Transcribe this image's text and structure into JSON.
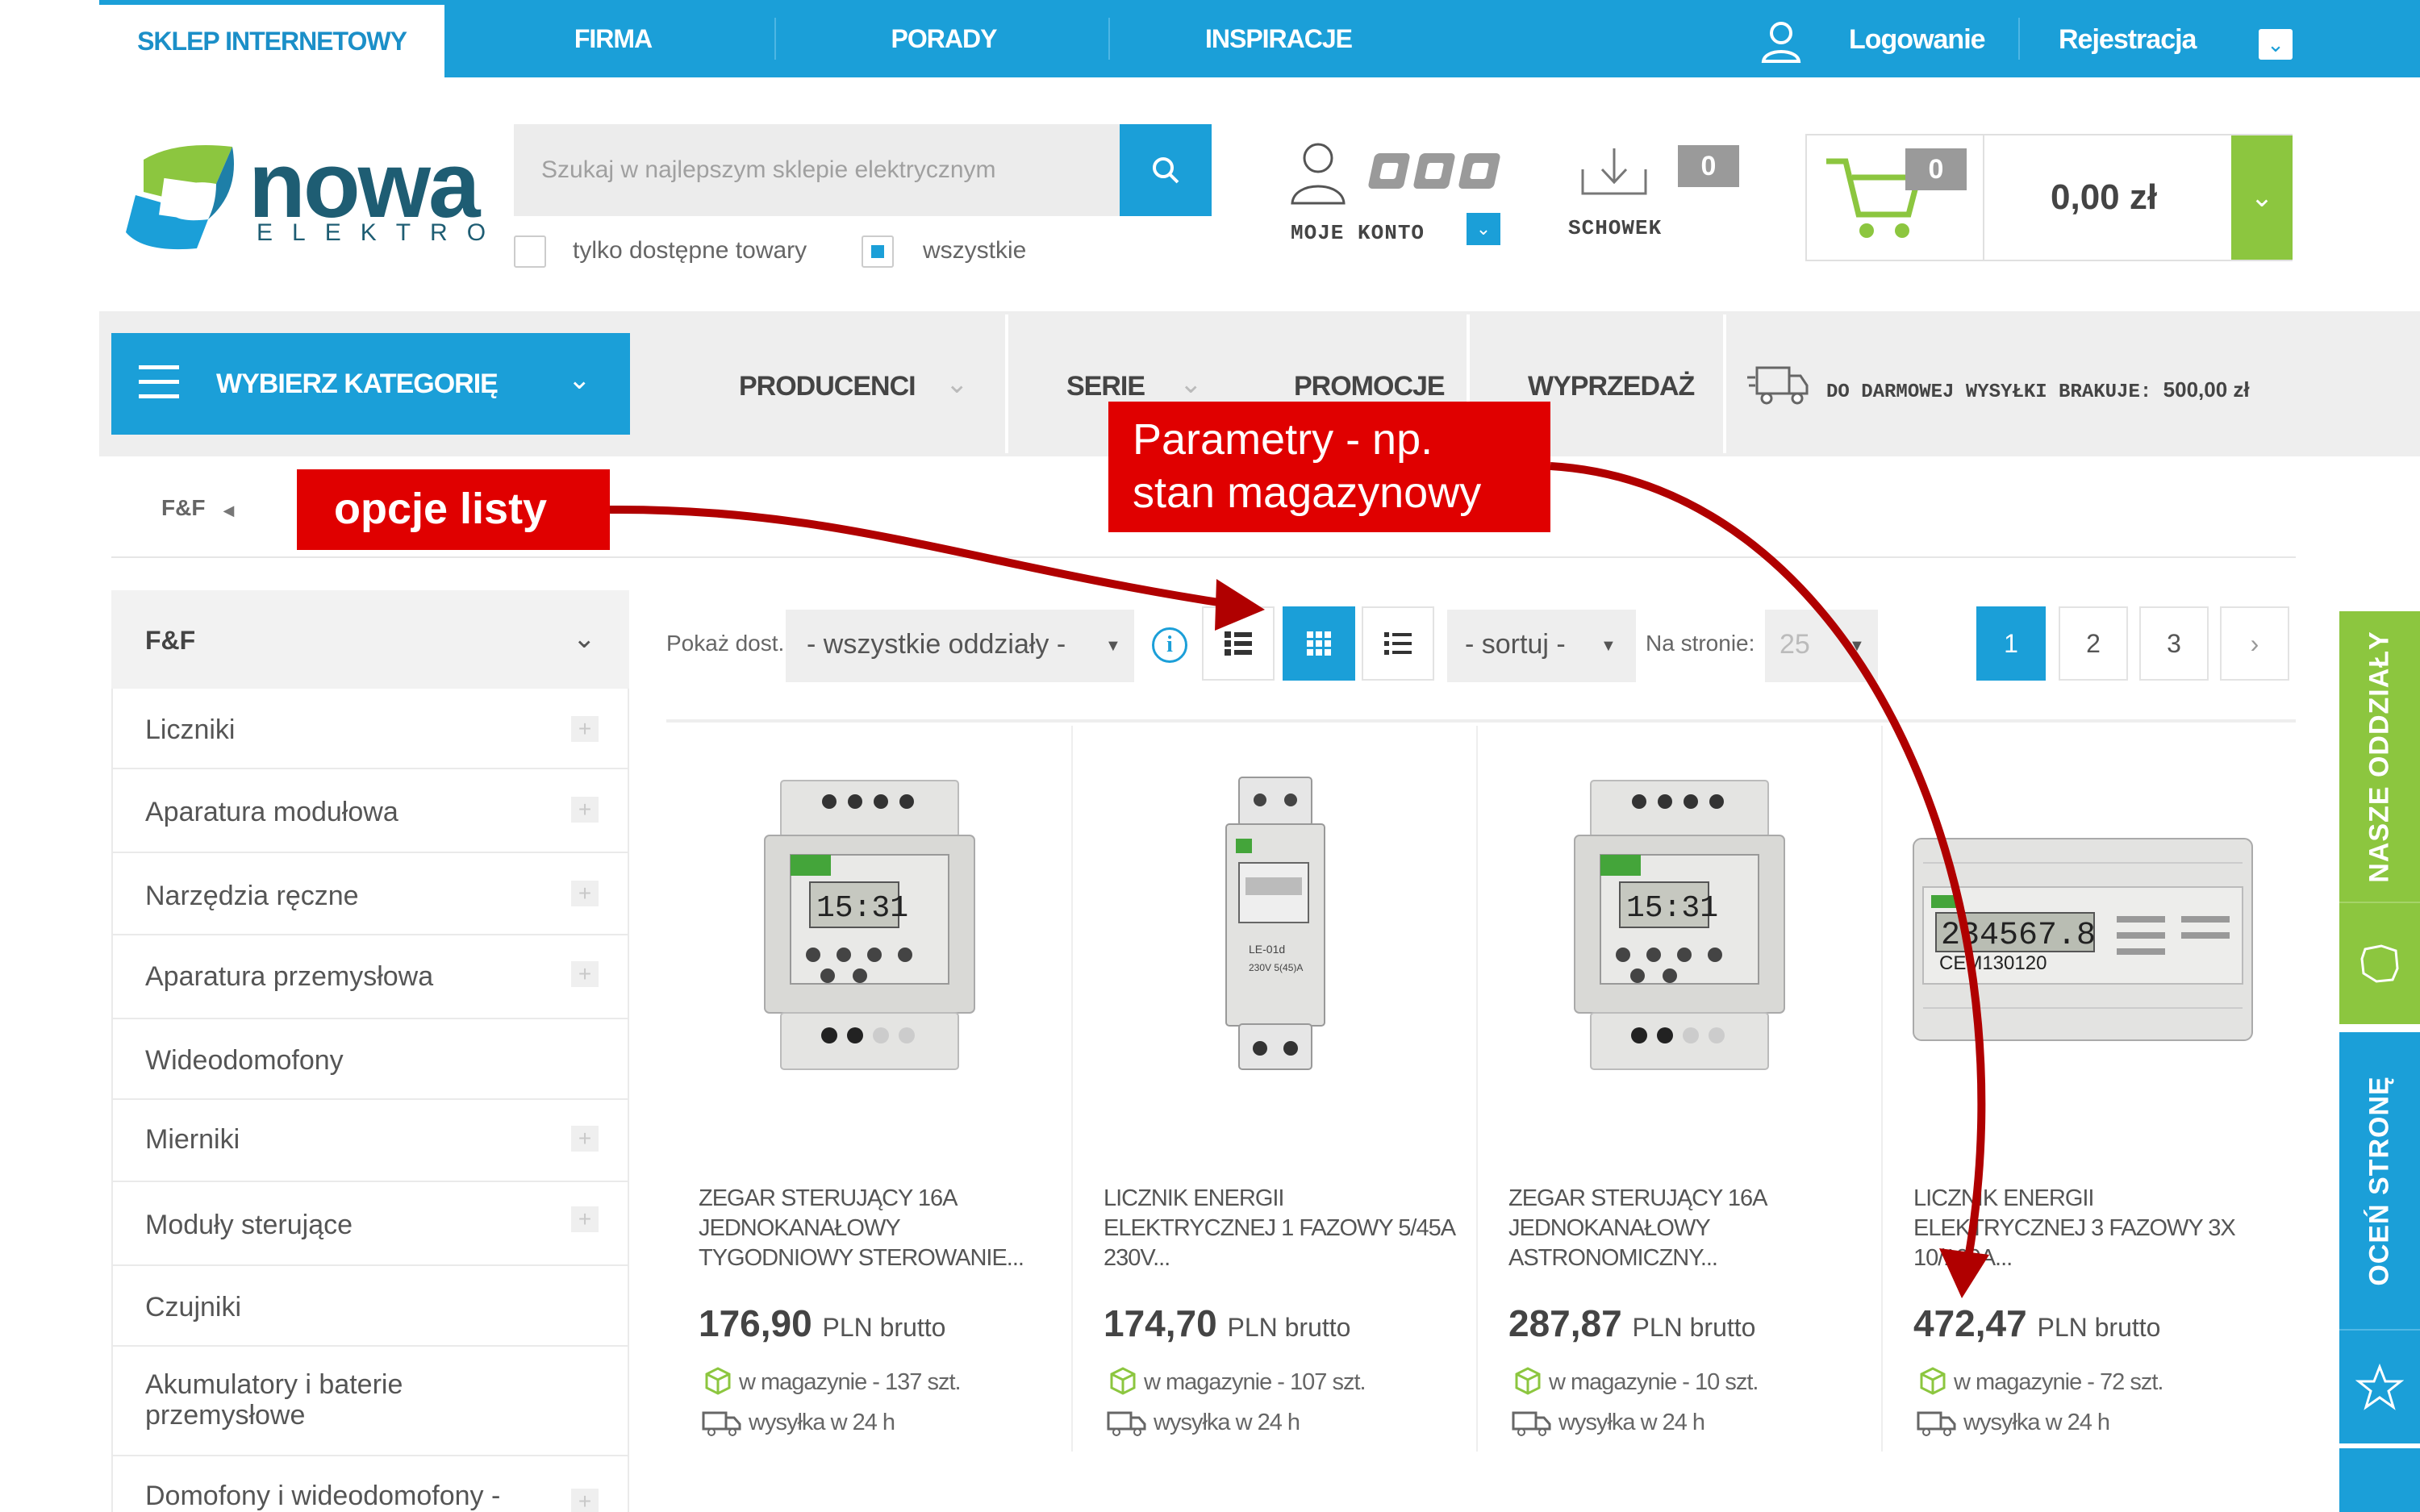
{
  "topbar": {
    "tabs": [
      {
        "label": "SKLEP INTERNETOWY",
        "active": true
      },
      {
        "label": "FIRMA"
      },
      {
        "label": "PORADY"
      },
      {
        "label": "INSPIRACJE"
      }
    ],
    "login": "Logowanie",
    "register": "Rejestracja"
  },
  "header": {
    "logo_word": "nowa",
    "logo_sub": "ELEKTRO",
    "search_placeholder": "Szukaj w najlepszym sklepie elektrycznym",
    "filter_available": "tylko dostępne towary",
    "filter_all": "wszystkie",
    "account_label": "MOJE KONTO",
    "clipboard_label": "SCHOWEK",
    "clipboard_count": "0",
    "cart_count": "0",
    "cart_total": "0,00 zł"
  },
  "nav": {
    "category_button": "WYBIERZ KATEGORIĘ",
    "items": [
      "PRODUCENCI",
      "SERIE",
      "PROMOCJE",
      "WYPRZEDAŻ"
    ],
    "shipping_text": "DO DARMOWEJ WYSYŁKI BRAKUJE:",
    "shipping_amount": "500,00 zł"
  },
  "breadcrumb": "F&F",
  "sidebar": {
    "header": "F&F",
    "items": [
      {
        "label": "Liczniki",
        "expandable": true
      },
      {
        "label": "Aparatura modułowa",
        "expandable": true
      },
      {
        "label": "Narzędzia ręczne",
        "expandable": true
      },
      {
        "label": "Aparatura przemysłowa",
        "expandable": true
      },
      {
        "label": "Wideodomofony",
        "expandable": false
      },
      {
        "label": "Mierniki",
        "expandable": true
      },
      {
        "label": "Moduły sterujące",
        "expandable": true
      },
      {
        "label": "Czujniki",
        "expandable": false
      },
      {
        "label": "Akumulatory i baterie przemysłowe",
        "expandable": false
      },
      {
        "label": "Domofony i wideodomofony -",
        "expandable": true
      }
    ]
  },
  "toolbar": {
    "show_label": "Pokaż dost.:",
    "branch_select": "- wszystkie oddziały -",
    "sort_select": "- sortuj -",
    "per_page_label": "Na stronie:",
    "per_page_value": "25",
    "pages": [
      "1",
      "2",
      "3"
    ],
    "current_page": "1"
  },
  "products": [
    {
      "name": "ZEGAR STERUJĄCY 16A JEDNOKANAŁOWY TYGODNIOWY STEROWANIE...",
      "price": "176,90",
      "unit": "PLN brutto",
      "stock": "w magazynie - 137 szt.",
      "shipping": "wysyłka w 24 h"
    },
    {
      "name": "LICZNIK ENERGII ELEKTRYCZNEJ 1 FAZOWY 5/45A 230V...",
      "price": "174,70",
      "unit": "PLN brutto",
      "stock": "w magazynie - 107 szt.",
      "shipping": "wysyłka w 24 h"
    },
    {
      "name": "ZEGAR STERUJĄCY 16A JEDNOKANAŁOWY ASTRONOMICZNY...",
      "price": "287,87",
      "unit": "PLN brutto",
      "stock": "w magazynie - 10 szt.",
      "shipping": "wysyłka w 24 h"
    },
    {
      "name": "LICZNIK ENERGII ELEKTRYCZNEJ 3 FAZOWY 3X 10/100A...",
      "price": "472,47",
      "unit": "PLN brutto",
      "stock": "w magazynie - 72 szt.",
      "shipping": "wysyłka w 24 h"
    }
  ],
  "side_tabs": {
    "branches": "NASZE ODDZIAŁY",
    "rate": "OCEŃ STRONĘ"
  },
  "annotations": {
    "list_options": "opcje listy",
    "params_line1": "Parametry - np.",
    "params_line2": "stan magazynowy"
  },
  "colors": {
    "brand_blue": "#1b9fd8",
    "brand_green": "#8cc63f",
    "annotation_red": "#e00000",
    "arrow_red": "#b00000"
  }
}
